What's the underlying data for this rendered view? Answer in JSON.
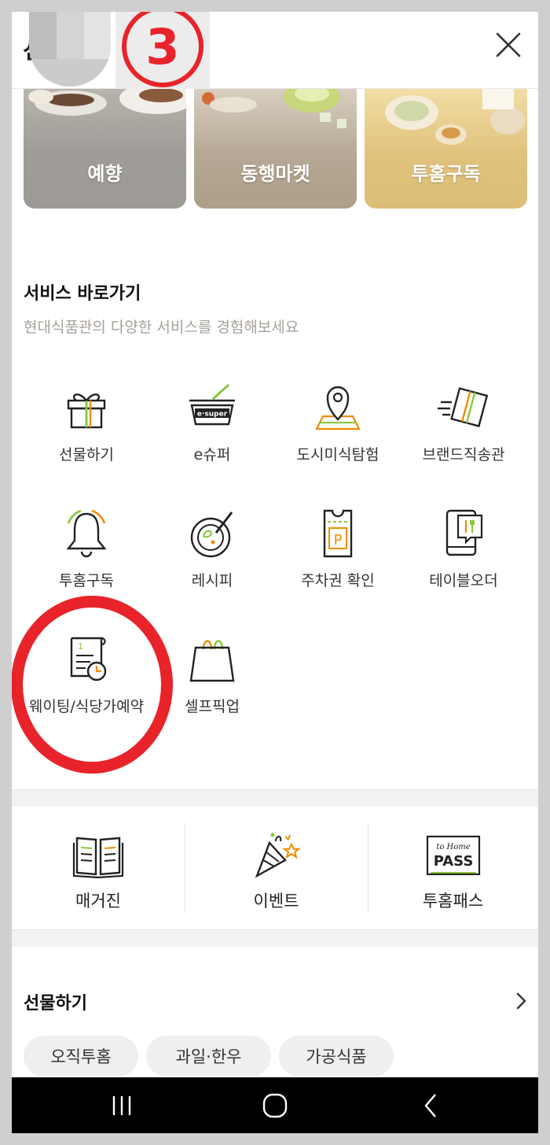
{
  "header": {
    "title_glyph": "선",
    "step_badge": "3",
    "close_icon": "close-icon"
  },
  "categories": [
    {
      "label": "예향"
    },
    {
      "label": "동행마켓"
    },
    {
      "label": "투홈구독"
    }
  ],
  "services": {
    "title": "서비스 바로가기",
    "subtitle": "현대식품관의 다양한 서비스를 경험해보세요",
    "items": [
      {
        "label": "선물하기",
        "icon": "gift-box-icon"
      },
      {
        "label": "e슈퍼",
        "icon": "esuper-basket-icon",
        "icon_text": "e·super"
      },
      {
        "label": "도시미식탐험",
        "icon": "map-pin-icon"
      },
      {
        "label": "브랜드직송관",
        "icon": "delivery-box-icon"
      },
      {
        "label": "투홈구독",
        "icon": "bell-icon"
      },
      {
        "label": "레시피",
        "icon": "recipe-bowl-icon"
      },
      {
        "label": "주차권 확인",
        "icon": "parking-ticket-icon",
        "icon_text": "P"
      },
      {
        "label": "테이블오더",
        "icon": "table-order-phone-icon"
      },
      {
        "label": "웨이팅/식당가예약",
        "icon": "waiting-receipt-clock-icon",
        "icon_text": "1"
      },
      {
        "label": "셀프픽업",
        "icon": "shopping-bag-icon"
      }
    ]
  },
  "quick_links": [
    {
      "label": "매거진",
      "icon": "magazine-book-icon"
    },
    {
      "label": "이벤트",
      "icon": "party-popper-icon"
    },
    {
      "label": "투홈패스",
      "icon": "tohome-pass-icon",
      "icon_text_top": "to Home",
      "icon_text_main": "PASS"
    }
  ],
  "gifts": {
    "title": "선물하기",
    "chips": [
      "오직투홈",
      "과일·한우",
      "가공식품"
    ]
  },
  "colors": {
    "accent_orange": "#f08c00",
    "accent_green": "#8cc63f",
    "highlight_red": "#e8242a"
  }
}
